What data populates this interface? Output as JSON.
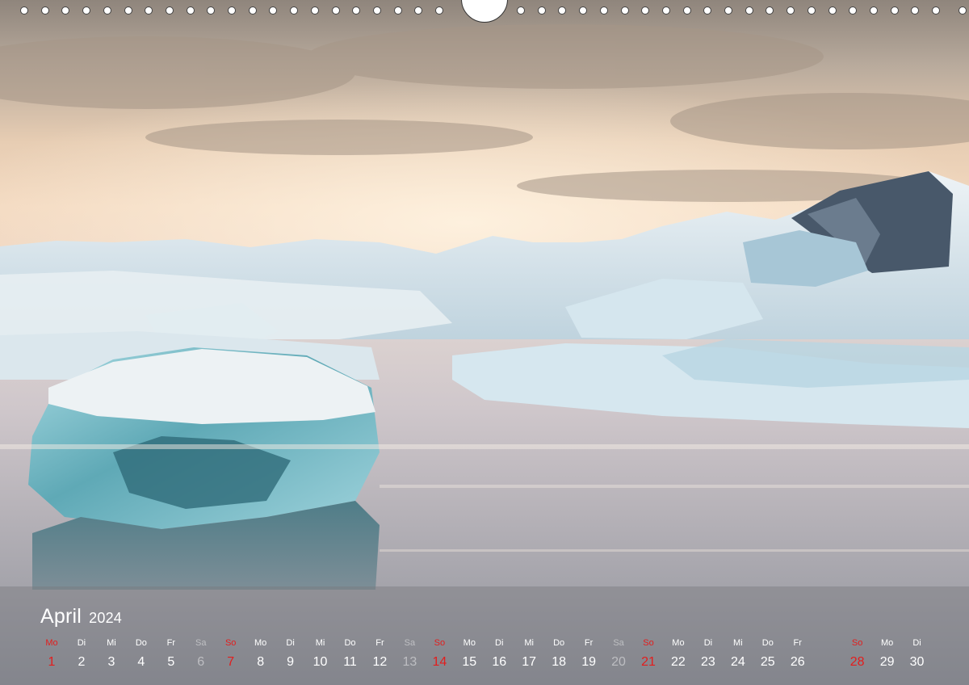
{
  "calendar": {
    "month": "April",
    "year": "2024",
    "days": [
      {
        "wd": "Mo",
        "d": "1",
        "t": "sun"
      },
      {
        "wd": "Di",
        "d": "2",
        "t": ""
      },
      {
        "wd": "Mi",
        "d": "3",
        "t": ""
      },
      {
        "wd": "Do",
        "d": "4",
        "t": ""
      },
      {
        "wd": "Fr",
        "d": "5",
        "t": ""
      },
      {
        "wd": "Sa",
        "d": "6",
        "t": "sat"
      },
      {
        "wd": "So",
        "d": "7",
        "t": "sun"
      },
      {
        "wd": "Mo",
        "d": "8",
        "t": ""
      },
      {
        "wd": "Di",
        "d": "9",
        "t": ""
      },
      {
        "wd": "Mi",
        "d": "10",
        "t": ""
      },
      {
        "wd": "Do",
        "d": "11",
        "t": ""
      },
      {
        "wd": "Fr",
        "d": "12",
        "t": ""
      },
      {
        "wd": "Sa",
        "d": "13",
        "t": "sat"
      },
      {
        "wd": "So",
        "d": "14",
        "t": "sun"
      },
      {
        "wd": "Mo",
        "d": "15",
        "t": ""
      },
      {
        "wd": "Di",
        "d": "16",
        "t": ""
      },
      {
        "wd": "Mi",
        "d": "17",
        "t": ""
      },
      {
        "wd": "Do",
        "d": "18",
        "t": ""
      },
      {
        "wd": "Fr",
        "d": "19",
        "t": ""
      },
      {
        "wd": "Sa",
        "d": "20",
        "t": "sat"
      },
      {
        "wd": "So",
        "d": "21",
        "t": "sun"
      },
      {
        "wd": "Mo",
        "d": "22",
        "t": ""
      },
      {
        "wd": "Di",
        "d": "23",
        "t": ""
      },
      {
        "wd": "Mi",
        "d": "24",
        "t": ""
      },
      {
        "wd": "Do",
        "d": "25",
        "t": ""
      },
      {
        "wd": "Fr",
        "d": "26",
        "t": ""
      },
      {
        "wd": "",
        "d": "",
        "t": ""
      },
      {
        "wd": "So",
        "d": "28",
        "t": "sun"
      },
      {
        "wd": "Mo",
        "d": "29",
        "t": ""
      },
      {
        "wd": "Di",
        "d": "30",
        "t": ""
      }
    ]
  },
  "colors": {
    "sunday": "#e31d1d",
    "text": "#ffffff",
    "bar": "#78787c"
  }
}
